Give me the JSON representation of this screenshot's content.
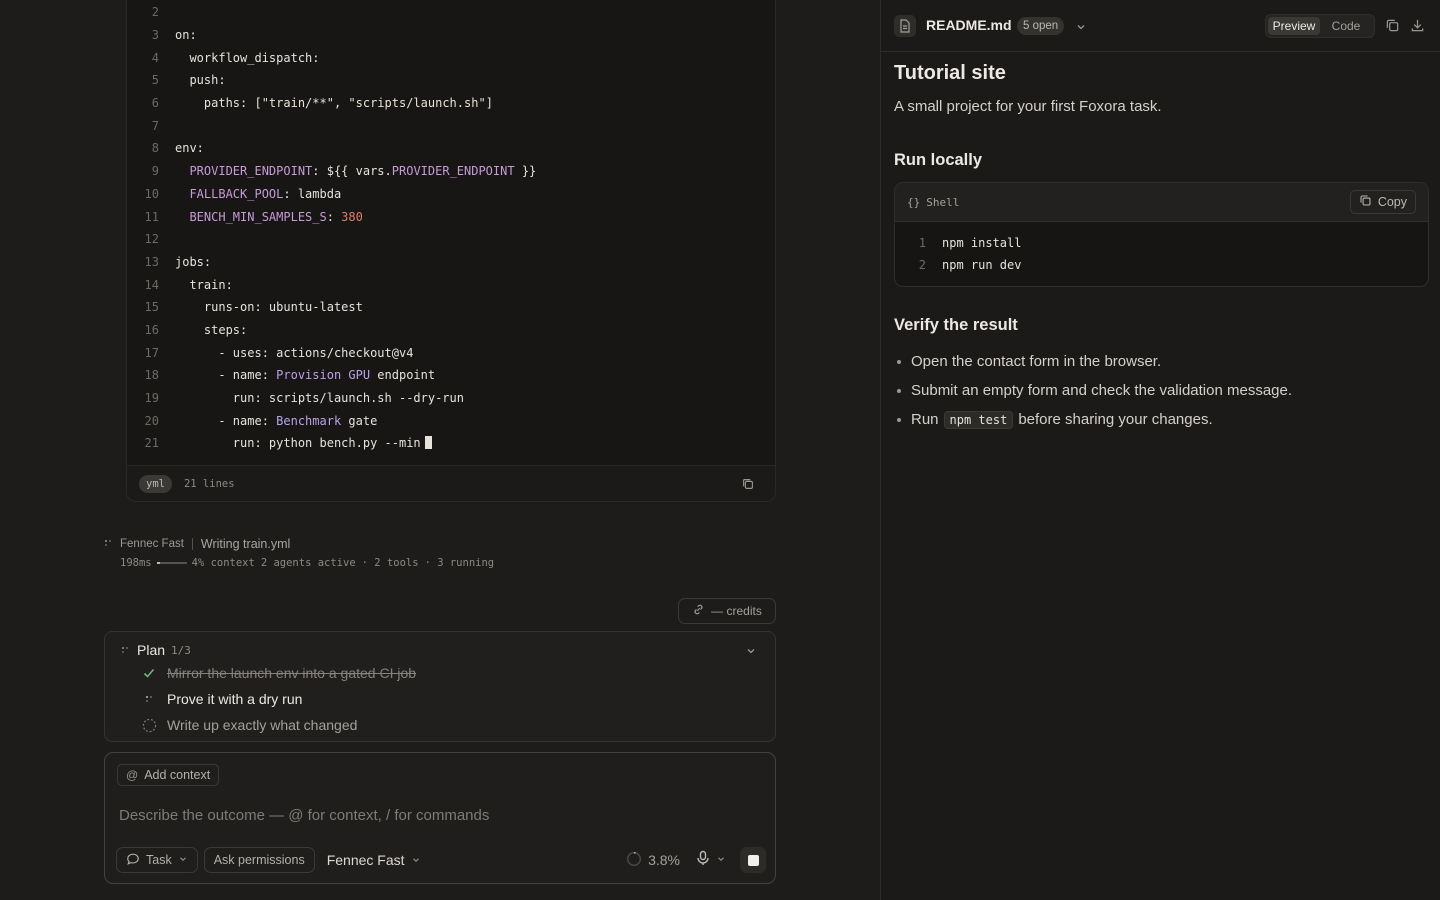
{
  "code_editor": {
    "lines": [
      {
        "n": "2",
        "segs": []
      },
      {
        "n": "3",
        "segs": [
          {
            "t": "on:",
            "c": "tok-key"
          }
        ]
      },
      {
        "n": "4",
        "segs": [
          {
            "t": "  workflow_dispatch:",
            "c": "tok-key"
          }
        ]
      },
      {
        "n": "5",
        "segs": [
          {
            "t": "  push:",
            "c": "tok-key"
          }
        ]
      },
      {
        "n": "6",
        "segs": [
          {
            "t": "    paths: [",
            "c": "tok-key"
          },
          {
            "t": "\"train/**\"",
            "c": "tok-str"
          },
          {
            "t": ", ",
            "c": "tok-key"
          },
          {
            "t": "\"scripts/launch.sh\"",
            "c": "tok-str"
          },
          {
            "t": "]",
            "c": "tok-key"
          }
        ]
      },
      {
        "n": "7",
        "segs": []
      },
      {
        "n": "8",
        "segs": [
          {
            "t": "env:",
            "c": "tok-key"
          }
        ]
      },
      {
        "n": "9",
        "segs": [
          {
            "t": "  PROVIDER_ENDPOINT",
            "c": "tok-var"
          },
          {
            "t": ": ${{ vars.",
            "c": "tok-key"
          },
          {
            "t": "PROVIDER_ENDPOINT",
            "c": "tok-var"
          },
          {
            "t": " }}",
            "c": "tok-key"
          }
        ]
      },
      {
        "n": "10",
        "segs": [
          {
            "t": "  FALLBACK_POOL",
            "c": "tok-var"
          },
          {
            "t": ": lambda",
            "c": "tok-key"
          }
        ]
      },
      {
        "n": "11",
        "segs": [
          {
            "t": "  BENCH_MIN_SAMPLES_S",
            "c": "tok-var"
          },
          {
            "t": ": ",
            "c": "tok-key"
          },
          {
            "t": "380",
            "c": "tok-num"
          }
        ]
      },
      {
        "n": "12",
        "segs": []
      },
      {
        "n": "13",
        "segs": [
          {
            "t": "jobs:",
            "c": "tok-key"
          }
        ]
      },
      {
        "n": "14",
        "segs": [
          {
            "t": "  train:",
            "c": "tok-key"
          }
        ]
      },
      {
        "n": "15",
        "segs": [
          {
            "t": "    runs-on: ubuntu-latest",
            "c": "tok-key"
          }
        ]
      },
      {
        "n": "16",
        "segs": [
          {
            "t": "    steps:",
            "c": "tok-key"
          }
        ]
      },
      {
        "n": "17",
        "segs": [
          {
            "t": "      - uses: actions/checkout@v4",
            "c": "tok-key"
          }
        ]
      },
      {
        "n": "18",
        "segs": [
          {
            "t": "      - name: ",
            "c": "tok-key"
          },
          {
            "t": "Provision GPU",
            "c": "tok-purple"
          },
          {
            "t": " endpoint",
            "c": "tok-key"
          }
        ]
      },
      {
        "n": "19",
        "segs": [
          {
            "t": "        run: scripts/launch.sh --dry-run",
            "c": "tok-key"
          }
        ]
      },
      {
        "n": "20",
        "segs": [
          {
            "t": "      - name: ",
            "c": "tok-key"
          },
          {
            "t": "Benchmark",
            "c": "tok-purple"
          },
          {
            "t": " gate",
            "c": "tok-key"
          }
        ]
      },
      {
        "n": "21",
        "segs": [
          {
            "t": "        run: python bench.py --min",
            "c": "tok-key"
          }
        ],
        "cursor": true
      }
    ],
    "footer": {
      "lang": "yml",
      "lines_label": "21 lines"
    }
  },
  "agent_status": {
    "model": "Fennec Fast",
    "activity": "Writing train.yml",
    "latency": "198ms",
    "context_fraction": 0.04,
    "context_label": "4% context",
    "agents": "2 agents active",
    "tools": "· 2 tools",
    "running": "· 3 running"
  },
  "credits": {
    "label": "— credits"
  },
  "plan": {
    "title": "Plan",
    "count": "1/3",
    "items": [
      {
        "label": "Mirror the launch env into a gated CI job",
        "state": "done"
      },
      {
        "label": "Prove it with a dry run",
        "state": "active"
      },
      {
        "label": "Write up exactly what changed",
        "state": "pending"
      }
    ]
  },
  "composer": {
    "add_context": "Add context",
    "placeholder": "Describe the outcome — @ for context, / for commands",
    "mode": "Task",
    "permissions": "Ask permissions",
    "model": "Fennec Fast",
    "context_pct": "3.8%"
  },
  "preview_panel": {
    "file_name": "README.md",
    "open_count": "5 open",
    "tabs": [
      "Preview",
      "Code"
    ],
    "active_tab": "Preview",
    "doc": {
      "title": "Tutorial site",
      "lead": "A small project for your first Foxora task.",
      "section1": "Run locally",
      "shell_label": "Shell",
      "shell_braces": "{}",
      "copy_label": "Copy",
      "shell_lines": [
        {
          "n": "1",
          "text": "npm install"
        },
        {
          "n": "2",
          "text": "npm run dev"
        }
      ],
      "section2": "Verify the result",
      "bullet1": "Open the contact form in the browser.",
      "bullet2": "Submit an empty form and check the validation message.",
      "bullet3_pre": "Run",
      "bullet3_code": "npm test",
      "bullet3_post": "before sharing your changes."
    }
  },
  "colors": {
    "accent_check": "#6fb37a",
    "bg": "#1d1c1b",
    "panel": "#1b1a19"
  }
}
